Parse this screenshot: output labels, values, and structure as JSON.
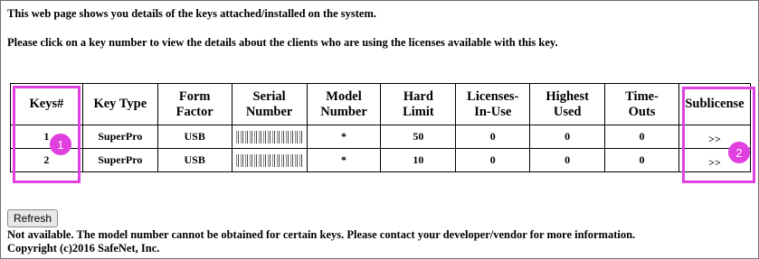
{
  "intro": {
    "line1": "This web page shows you details of the keys attached/installed on the system.",
    "line2": "Please click on a key number to view the details about the clients who are using the licenses available with this key."
  },
  "table": {
    "headers": [
      {
        "line1": "Keys#",
        "line2": ""
      },
      {
        "line1": "Key Type",
        "line2": ""
      },
      {
        "line1": "Form",
        "line2": "Factor"
      },
      {
        "line1": "Serial",
        "line2": "Number"
      },
      {
        "line1": "Model",
        "line2": "Number"
      },
      {
        "line1": "Hard",
        "line2": "Limit"
      },
      {
        "line1": "Licenses-",
        "line2": "In-Use"
      },
      {
        "line1": "Highest",
        "line2": "Used"
      },
      {
        "line1": "Time-",
        "line2": "Outs"
      },
      {
        "line1": "Sublicense",
        "line2": ""
      }
    ],
    "rows": [
      {
        "key": "1",
        "type": "SuperPro",
        "form": "USB",
        "model": "*",
        "limit": "50",
        "in_use": "0",
        "highest": "0",
        "timeouts": "0",
        "sublicense": ">>"
      },
      {
        "key": "2",
        "type": "SuperPro",
        "form": "USB",
        "model": "*",
        "limit": "10",
        "in_use": "0",
        "highest": "0",
        "timeouts": "0",
        "sublicense": ">>"
      }
    ]
  },
  "annotations": {
    "marker1": "1",
    "marker2": "2",
    "color": "#e040e0"
  },
  "refresh_label": "Refresh",
  "footer": {
    "line1": "Not available. The model number cannot be obtained for certain keys. Please contact your developer/vendor for more information.",
    "line2": "Copyright (c)2016 SafeNet, Inc."
  }
}
